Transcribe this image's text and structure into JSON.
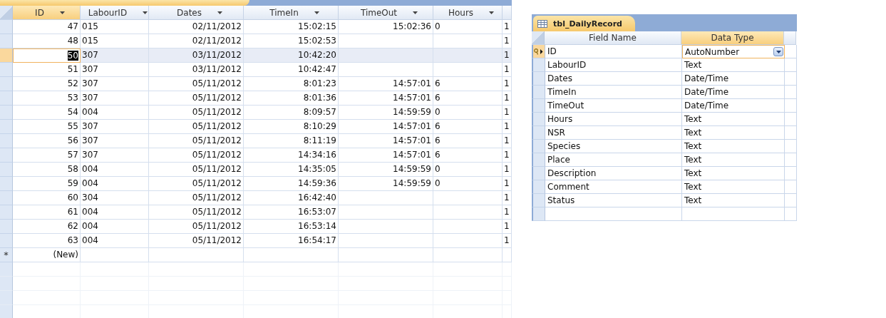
{
  "datasheet": {
    "columns": [
      {
        "label": "ID"
      },
      {
        "label": "LabourID"
      },
      {
        "label": "Dates"
      },
      {
        "label": "TimeIn"
      },
      {
        "label": "TimeOut"
      },
      {
        "label": "Hours"
      },
      {}
    ],
    "rows": [
      {
        "selected": false,
        "cells": [
          "47",
          "015",
          "02/11/2012",
          "15:02:15",
          "15:02:36",
          "0",
          "1"
        ]
      },
      {
        "selected": false,
        "cells": [
          "48",
          "015",
          "02/11/2012",
          "15:02:53",
          null,
          null,
          "1"
        ]
      },
      {
        "selected": true,
        "cells": [
          "50",
          "307",
          "03/11/2012",
          "10:42:20",
          null,
          null,
          "1"
        ]
      },
      {
        "selected": false,
        "cells": [
          "51",
          "307",
          "03/11/2012",
          "10:42:47",
          null,
          null,
          "1"
        ]
      },
      {
        "selected": false,
        "cells": [
          "52",
          "307",
          "05/11/2012",
          "8:01:23",
          "14:57:01",
          "6",
          "1"
        ]
      },
      {
        "selected": false,
        "cells": [
          "53",
          "307",
          "05/11/2012",
          "8:01:36",
          "14:57:01",
          "6",
          "1"
        ]
      },
      {
        "selected": false,
        "cells": [
          "54",
          "004",
          "05/11/2012",
          "8:09:57",
          "14:59:59",
          "0",
          "1"
        ]
      },
      {
        "selected": false,
        "cells": [
          "55",
          "307",
          "05/11/2012",
          "8:10:29",
          "14:57:01",
          "6",
          "1"
        ]
      },
      {
        "selected": false,
        "cells": [
          "56",
          "307",
          "05/11/2012",
          "8:11:19",
          "14:57:01",
          "6",
          "1"
        ]
      },
      {
        "selected": false,
        "cells": [
          "57",
          "307",
          "05/11/2012",
          "14:34:16",
          "14:57:01",
          "6",
          "1"
        ]
      },
      {
        "selected": false,
        "cells": [
          "58",
          "004",
          "05/11/2012",
          "14:35:05",
          "14:59:59",
          "0",
          "1"
        ]
      },
      {
        "selected": false,
        "cells": [
          "59",
          "004",
          "05/11/2012",
          "14:59:36",
          "14:59:59",
          "0",
          "1"
        ]
      },
      {
        "selected": false,
        "cells": [
          "60",
          "304",
          "05/11/2012",
          "16:42:40",
          null,
          null,
          "1"
        ]
      },
      {
        "selected": false,
        "cells": [
          "61",
          "004",
          "05/11/2012",
          "16:53:07",
          null,
          null,
          "1"
        ]
      },
      {
        "selected": false,
        "cells": [
          "62",
          "004",
          "05/11/2012",
          "16:53:14",
          null,
          null,
          "1"
        ]
      },
      {
        "selected": false,
        "cells": [
          "63",
          "004",
          "05/11/2012",
          "16:54:17",
          null,
          null,
          "1"
        ]
      }
    ],
    "new_row": {
      "marker": "*",
      "id": "(New)"
    }
  },
  "design": {
    "tab_title": "tbl_DailyRecord",
    "columns": [
      "Field Name",
      "Data Type"
    ],
    "fields": [
      {
        "name": "ID",
        "type": "AutoNumber",
        "primary_key": true,
        "selected": true
      },
      {
        "name": "LabourID",
        "type": "Text",
        "primary_key": false,
        "selected": false
      },
      {
        "name": "Dates",
        "type": "Date/Time",
        "primary_key": false,
        "selected": false
      },
      {
        "name": "TimeIn",
        "type": "Date/Time",
        "primary_key": false,
        "selected": false
      },
      {
        "name": "TimeOut",
        "type": "Date/Time",
        "primary_key": false,
        "selected": false
      },
      {
        "name": "Hours",
        "type": "Text",
        "primary_key": false,
        "selected": false
      },
      {
        "name": "NSR",
        "type": "Text",
        "primary_key": false,
        "selected": false
      },
      {
        "name": "Species",
        "type": "Text",
        "primary_key": false,
        "selected": false
      },
      {
        "name": "Place",
        "type": "Text",
        "primary_key": false,
        "selected": false
      },
      {
        "name": "Description",
        "type": "Text",
        "primary_key": false,
        "selected": false
      },
      {
        "name": "Comment",
        "type": "Text",
        "primary_key": false,
        "selected": false
      },
      {
        "name": "Status",
        "type": "Text",
        "primary_key": false,
        "selected": false
      }
    ]
  }
}
